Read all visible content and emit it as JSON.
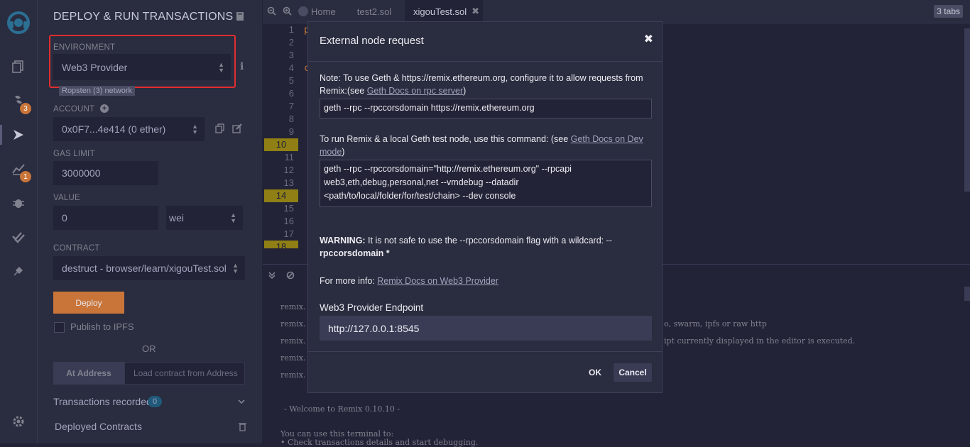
{
  "sidebar_rail": {
    "badges": [
      "3",
      "1"
    ]
  },
  "panel": {
    "title": "DEPLOY & RUN TRANSACTIONS",
    "environment": {
      "label": "ENVIRONMENT",
      "value": "Web3 Provider",
      "network": "Ropsten (3) network"
    },
    "account": {
      "label": "ACCOUNT",
      "value": "0x0F7...4e414 (0 ether)"
    },
    "gas_limit": {
      "label": "GAS LIMIT",
      "value": "3000000"
    },
    "value": {
      "label": "VALUE",
      "amount": "0",
      "unit": "wei"
    },
    "contract": {
      "label": "CONTRACT",
      "value": "destruct - browser/learn/xigouTest.sol"
    },
    "deploy_label": "Deploy",
    "publish_label": "Publish to IPFS",
    "or_label": "OR",
    "at_address_label": "At Address",
    "load_contract_placeholder": "Load contract from Address",
    "transactions_recorded_label": "Transactions recorded",
    "transactions_recorded_count": "0",
    "deployed_contracts_label": "Deployed Contracts"
  },
  "editor": {
    "tabs": [
      "Home",
      "test2.sol",
      "xigouTest.sol"
    ],
    "tab_count": "3 tabs",
    "line_numbers": [
      "1",
      "2",
      "3",
      "4",
      "5",
      "6",
      "7",
      "8",
      "9",
      "10",
      "11",
      "12",
      "13",
      "14",
      "15",
      "16",
      "17",
      "18"
    ],
    "code_fragments": [
      "p",
      "c"
    ],
    "terminal_lines": [
      "remix.",
      "remix.",
      "remix.",
      "remix.",
      "remix."
    ],
    "terminal_right_1": "o, swarm, ipfs or raw http",
    "terminal_right_2": "ipt currently displayed in the editor is executed.",
    "welcome": "- Welcome to Remix 0.10.10 -",
    "can_use": "You can use this terminal to:",
    "bullet": "• Check transactions details and start debugging."
  },
  "modal": {
    "title": "External node request",
    "close": "✖",
    "note_prefix": "Note: To use Geth & https://remix.ethereum.org, configure it to allow requests from Remix:(see ",
    "note_link": "Geth Docs on rpc server",
    "note_suffix": ")",
    "cmd1": "geth --rpc --rpccorsdomain https://remix.ethereum.org",
    "run_prefix": "To run Remix & a local Geth test node, use this command: (see ",
    "run_link": "Geth Docs on Dev mode",
    "run_suffix": ")",
    "cmd2_line1": "geth --rpc --rpccorsdomain=\"http://remix.ethereum.org\" --rpcapi",
    "cmd2_line2": "web3,eth,debug,personal,net --vmdebug --datadir",
    "cmd2_line3": "<path/to/local/folder/for/test/chain> --dev console",
    "warning_bold": "WARNING:",
    "warning_text": " It is not safe to use the --rpccorsdomain flag with a wildcard: --",
    "warning_line2": "rpccorsdomain *",
    "info_prefix": "For more info: ",
    "info_link": "Remix Docs on Web3 Provider",
    "endpoint_label": "Web3 Provider Endpoint",
    "endpoint_value": "http://127.0.0.1:8545",
    "ok_label": "OK",
    "cancel_label": "Cancel"
  }
}
